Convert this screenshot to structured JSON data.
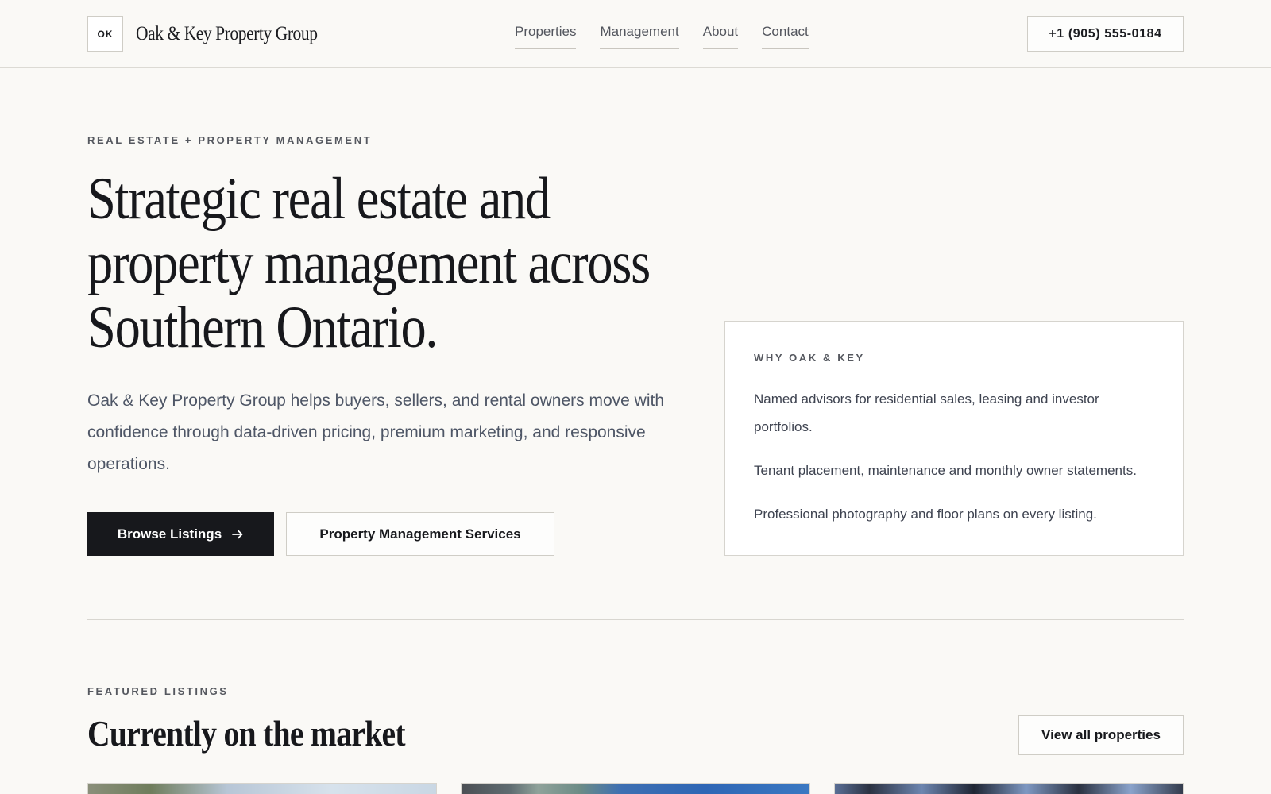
{
  "header": {
    "brand_mark": "OK",
    "brand_name": "Oak & Key Property Group",
    "nav": [
      "Properties",
      "Management",
      "About",
      "Contact"
    ],
    "phone": "+1 (905) 555-0184"
  },
  "hero": {
    "eyebrow": "REAL ESTATE + PROPERTY MANAGEMENT",
    "title": "Strategic real estate and property management across Southern Ontario.",
    "description": "Oak & Key Property Group helps buyers, sellers, and rental owners move with confidence through data-driven pricing, premium marketing, and responsive operations.",
    "primary_cta": "Browse Listings",
    "secondary_cta": "Property Management Services",
    "primary_cta_icon": "arrow-right-icon"
  },
  "why": {
    "eyebrow": "WHY OAK & KEY",
    "items": [
      "Named advisors for residential sales, leasing and investor portfolios.",
      "Tenant placement, maintenance and monthly owner statements.",
      "Professional photography and floor plans on every listing."
    ]
  },
  "featured": {
    "eyebrow": "FEATURED LISTINGS",
    "title": "Currently on the market",
    "view_all": "View all properties"
  },
  "colors": {
    "background": "#faf9f6",
    "ink": "#17181c",
    "muted_text": "#4e5666",
    "border": "#cfcdc6"
  }
}
